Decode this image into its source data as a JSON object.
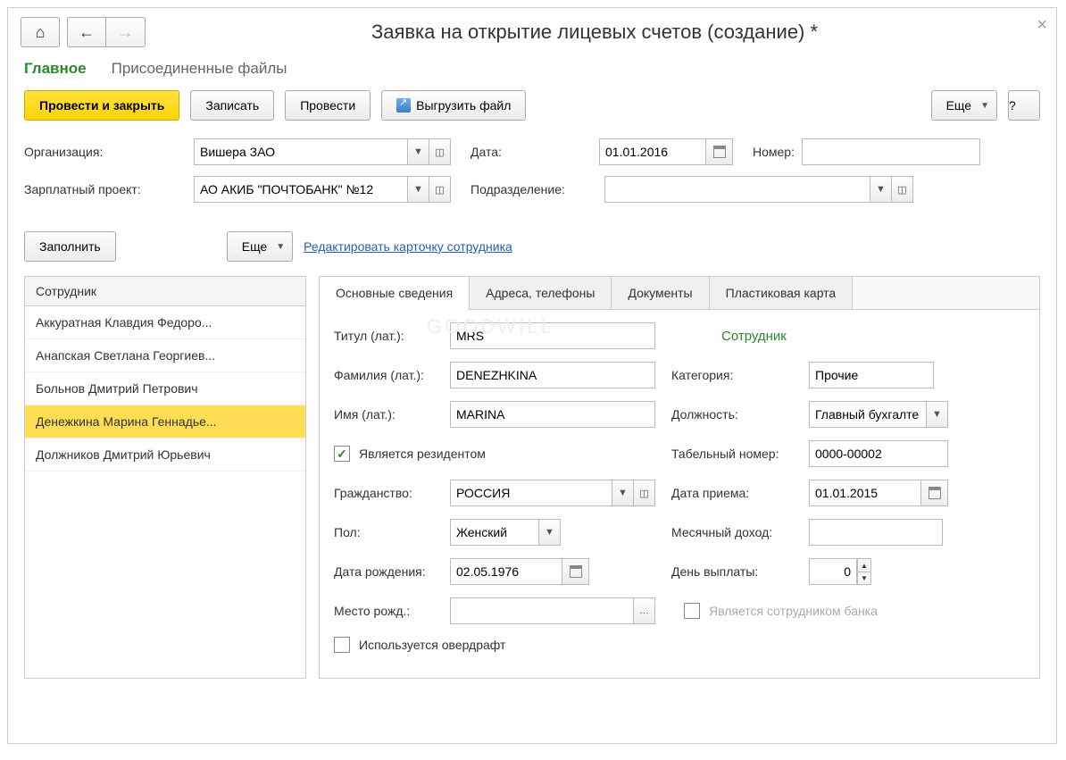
{
  "window": {
    "title": "Заявка на открытие лицевых счетов (создание) *"
  },
  "sectionTabs": {
    "main": "Главное",
    "files": "Присоединенные файлы"
  },
  "toolbar": {
    "postAndClose": "Провести и закрыть",
    "save": "Записать",
    "post": "Провести",
    "export": "Выгрузить файл",
    "more": "Еще",
    "help": "?"
  },
  "form": {
    "orgLabel": "Организация:",
    "orgValue": "Вишера ЗАО",
    "dateLabel": "Дата:",
    "dateValue": "01.01.2016",
    "numberLabel": "Номер:",
    "numberValue": "",
    "projectLabel": "Зарплатный проект:",
    "projectValue": "АО АКИБ \"ПОЧТОБАНК\" №12",
    "deptLabel": "Подразделение:",
    "deptValue": ""
  },
  "row2": {
    "fill": "Заполнить",
    "more": "Еще",
    "editCard": "Редактировать карточку сотрудника"
  },
  "employees": {
    "header": "Сотрудник",
    "items": [
      "Аккуратная Клавдия Федоро...",
      "Анапская Светлана Георгиев...",
      "Больнов Дмитрий Петрович",
      "Денежкина Марина Геннадье...",
      "Должников Дмитрий Юрьевич"
    ],
    "selectedIndex": 3
  },
  "detailTabs": {
    "t0": "Основные сведения",
    "t1": "Адреса, телефоны",
    "t2": "Документы",
    "t3": "Пластиковая карта"
  },
  "detail": {
    "titleLbl": "Титул (лат.):",
    "titleVal": "MRS",
    "empHead": "Сотрудник",
    "surnameLbl": "Фамилия (лат.):",
    "surnameVal": "DENEZHKINA",
    "categoryLbl": "Категория:",
    "categoryVal": "Прочие",
    "nameLbl": "Имя (лат.):",
    "nameVal": "MARINA",
    "positionLbl": "Должность:",
    "positionVal": "Главный бухгалте",
    "residentLbl": "Является резидентом",
    "tabNumLbl": "Табельный номер:",
    "tabNumVal": "0000-00002",
    "citizenLbl": "Гражданство:",
    "citizenVal": "РОССИЯ",
    "hireDateLbl": "Дата приема:",
    "hireDateVal": "01.01.2015",
    "sexLbl": "Пол:",
    "sexVal": "Женский",
    "incomeLbl": "Месячный доход:",
    "incomeVal": "",
    "birthLbl": "Дата рождения:",
    "birthVal": "02.05.1976",
    "payDayLbl": "День выплаты:",
    "payDayVal": "0",
    "birthPlaceLbl": "Место рожд.:",
    "birthPlaceVal": "",
    "bankEmpLbl": "Является сотрудником банка",
    "overdraftLbl": "Используется овердрафт"
  },
  "watermark": "GOODWILL"
}
